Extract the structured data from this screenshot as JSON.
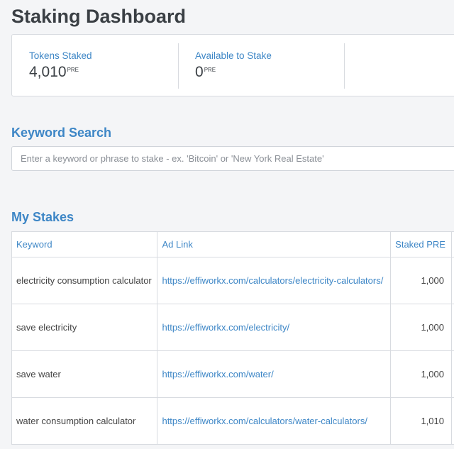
{
  "page": {
    "title": "Staking Dashboard"
  },
  "stats": [
    {
      "label": "Tokens Staked",
      "value": "4,010",
      "unit": "PRE"
    },
    {
      "label": "Available to Stake",
      "value": "0",
      "unit": "PRE"
    }
  ],
  "keyword_search": {
    "title": "Keyword Search",
    "placeholder": "Enter a keyword or phrase to stake - ex. 'Bitcoin' or 'New York Real Estate'"
  },
  "my_stakes": {
    "title": "My Stakes",
    "columns": [
      "Keyword",
      "Ad Link",
      "Staked PRE"
    ],
    "rows": [
      {
        "keyword": "electricity consumption calculator",
        "link": "https://effiworkx.com/calculators/electricity-calculators/",
        "staked": "1,000"
      },
      {
        "keyword": "save electricity",
        "link": "https://effiworkx.com/electricity/",
        "staked": "1,000"
      },
      {
        "keyword": "save water",
        "link": "https://effiworkx.com/water/",
        "staked": "1,000"
      },
      {
        "keyword": "water consumption calculator",
        "link": "https://effiworkx.com/calculators/water-calculators/",
        "staked": "1,010"
      }
    ]
  },
  "colors": {
    "accent": "#3d86c6",
    "heading": "#3a3f44",
    "border": "#d8dbe0"
  }
}
